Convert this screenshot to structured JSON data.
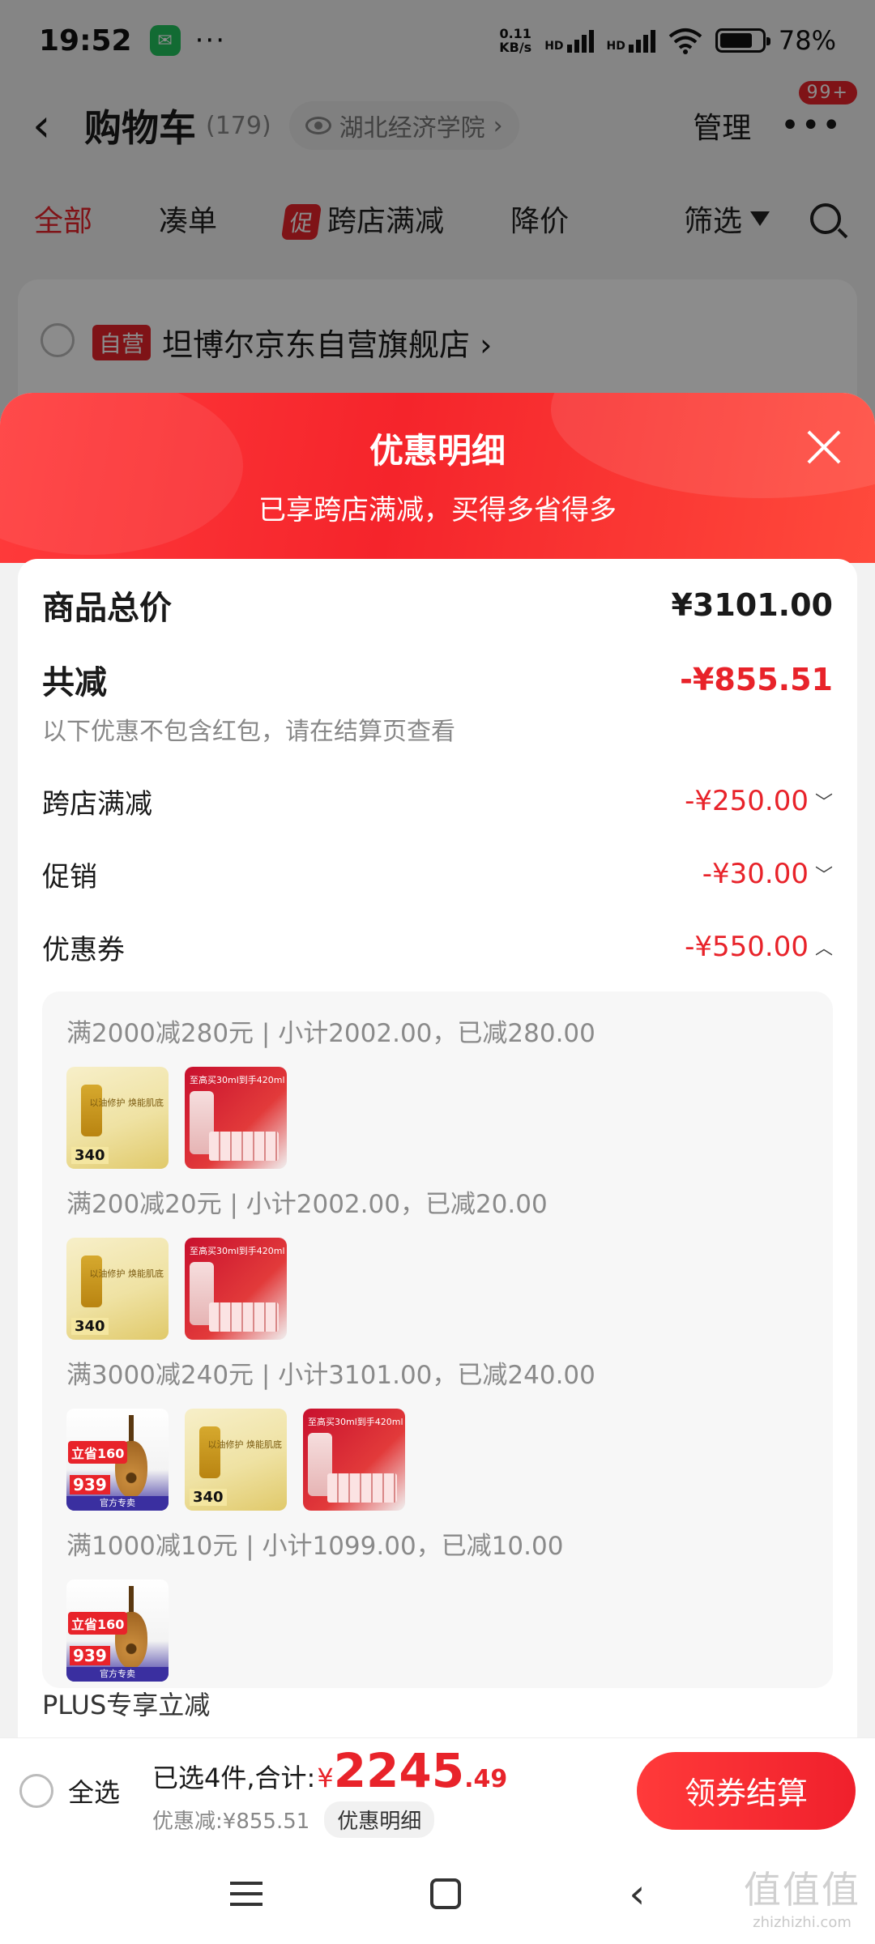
{
  "status_bar": {
    "time": "19:52",
    "net_speed_value": "0.11",
    "net_speed_unit": "KB/s",
    "sig1": "HD",
    "sig2": "HD",
    "battery": "78%"
  },
  "cart_header": {
    "title": "购物车",
    "count": "(179)",
    "location": "湖北经济学院",
    "manage": "管理",
    "more_badge": "99+"
  },
  "filter_bar": {
    "tabs": [
      "全部",
      "凑单"
    ],
    "promo_tag": "促",
    "promo_label": "跨店满减",
    "price_drop": "降价",
    "filter": "筛选"
  },
  "store": {
    "tag": "自营",
    "name": "坦博尔京东自营旗舰店 ›"
  },
  "sheet": {
    "title": "优惠明细",
    "subtitle": "已享跨店满减，买得多省得多",
    "total_label": "商品总价",
    "total_value": "¥3101.00",
    "save_label": "共减",
    "save_value": "-¥855.51",
    "save_note": "以下优惠不包含红包，请在结算页查看",
    "items": [
      {
        "label": "跨店满减",
        "amount": "-¥250.00",
        "chevron": "﹀"
      },
      {
        "label": "促销",
        "amount": "-¥30.00",
        "chevron": "﹀"
      },
      {
        "label": "优惠券",
        "amount": "-¥550.00",
        "chevron": "︿"
      }
    ],
    "coupon_groups": [
      {
        "title": "满2000减280元 | 小计2002.00，已减280.00"
      },
      {
        "title": "满200减20元 | 小计2002.00，已减20.00"
      },
      {
        "title": "满3000减240元 | 小计3101.00，已减240.00"
      },
      {
        "title": "满1000减10元 | 小计1099.00，已减10.00"
      }
    ],
    "thumb_text": {
      "serum_label": "以油修护 焕能肌底",
      "serum_price": "340",
      "sk_label": "至高买30ml到手420ml",
      "guitar_badge": "立省160",
      "guitar_price": "939",
      "guitar_banner": "官方专卖"
    },
    "plus_row": "PLUS专享立减"
  },
  "checkout": {
    "select_all": "全选",
    "summary_prefix": "已选4件,合计:",
    "currency": "¥",
    "total_int": "2245",
    "total_dec": ".49",
    "discount": "优惠减:¥855.51",
    "detail_button": "优惠明细",
    "checkout_button": "领券结算"
  },
  "watermark": {
    "big": "值值值",
    "small": "zhizhizhi.com"
  },
  "colors": {
    "accent": "#e8232a",
    "header_gradient_start": "#ff3b3b",
    "header_gradient_end": "#ff4a3c"
  }
}
